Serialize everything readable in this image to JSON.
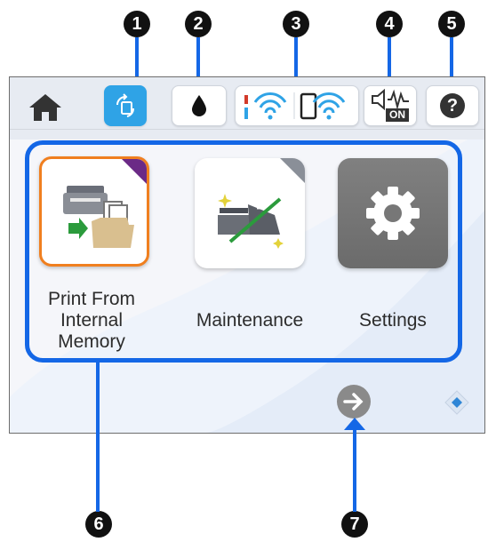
{
  "callouts": [
    "1",
    "2",
    "3",
    "4",
    "5",
    "6",
    "7"
  ],
  "status_bar": {
    "home_icon": "home-icon",
    "items": [
      {
        "name": "wireless-direct-connect",
        "icon": "device-rotate-icon"
      },
      {
        "name": "ink-status",
        "icon": "ink-drop-icon"
      },
      {
        "name": "network-status",
        "icon": "wifi-signal-icon"
      },
      {
        "name": "quiet-mode",
        "icon": "speaker-wave-icon",
        "badge": "ON"
      },
      {
        "name": "help",
        "icon": "help-icon",
        "label": "?"
      }
    ]
  },
  "menu": {
    "items": [
      {
        "label_lines": [
          "Print From",
          "Internal",
          "Memory"
        ],
        "icon": "print-from-memory-icon",
        "selected": true
      },
      {
        "label_lines": [
          "Maintenance"
        ],
        "icon": "maintenance-icon",
        "selected": false
      },
      {
        "label_lines": [
          "Settings"
        ],
        "icon": "gear-icon",
        "selected": false
      }
    ]
  },
  "nav": {
    "next_icon": "arrow-right-icon",
    "page_icon": "diamond-icon"
  },
  "colors": {
    "accent": "#1467e6",
    "active": "#2fa3e6",
    "selected_border": "#f07f1f"
  }
}
